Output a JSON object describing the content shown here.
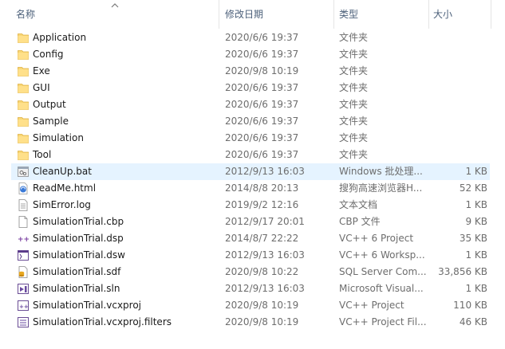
{
  "columns": {
    "name": "名称",
    "date": "修改日期",
    "type": "类型",
    "size": "大小"
  },
  "files": [
    {
      "name": "Application",
      "date": "2020/6/6 19:37",
      "type": "文件夹",
      "size": "",
      "icon": "folder-icon"
    },
    {
      "name": "Config",
      "date": "2020/6/6 19:37",
      "type": "文件夹",
      "size": "",
      "icon": "folder-icon"
    },
    {
      "name": "Exe",
      "date": "2020/9/8 10:19",
      "type": "文件夹",
      "size": "",
      "icon": "folder-icon"
    },
    {
      "name": "GUI",
      "date": "2020/6/6 19:37",
      "type": "文件夹",
      "size": "",
      "icon": "folder-icon"
    },
    {
      "name": "Output",
      "date": "2020/6/6 19:37",
      "type": "文件夹",
      "size": "",
      "icon": "folder-icon"
    },
    {
      "name": "Sample",
      "date": "2020/6/6 19:37",
      "type": "文件夹",
      "size": "",
      "icon": "folder-icon"
    },
    {
      "name": "Simulation",
      "date": "2020/6/6 19:37",
      "type": "文件夹",
      "size": "",
      "icon": "folder-icon"
    },
    {
      "name": "Tool",
      "date": "2020/6/6 19:37",
      "type": "文件夹",
      "size": "",
      "icon": "folder-icon"
    },
    {
      "name": "CleanUp.bat",
      "date": "2012/9/13 16:03",
      "type": "Windows 批处理...",
      "size": "1 KB",
      "icon": "batch-file-icon",
      "hover": true
    },
    {
      "name": "ReadMe.html",
      "date": "2014/8/8 20:13",
      "type": "搜狗高速浏览器H...",
      "size": "52 KB",
      "icon": "html-file-icon"
    },
    {
      "name": "SimError.log",
      "date": "2019/9/2 12:16",
      "type": "文本文档",
      "size": "1 KB",
      "icon": "text-file-icon"
    },
    {
      "name": "SimulationTrial.cbp",
      "date": "2012/9/17 20:01",
      "type": "CBP 文件",
      "size": "9 KB",
      "icon": "blank-file-icon"
    },
    {
      "name": "SimulationTrial.dsp",
      "date": "2014/8/7 22:22",
      "type": "VC++ 6 Project",
      "size": "35 KB",
      "icon": "vc-project-icon"
    },
    {
      "name": "SimulationTrial.dsw",
      "date": "2012/9/13 16:03",
      "type": "VC++ 6 Worksp...",
      "size": "1 KB",
      "icon": "vc-workspace-icon"
    },
    {
      "name": "SimulationTrial.sdf",
      "date": "2020/9/8 10:22",
      "type": "SQL Server Com...",
      "size": "33,856 KB",
      "icon": "database-file-icon"
    },
    {
      "name": "SimulationTrial.sln",
      "date": "2012/9/13 16:03",
      "type": "Microsoft Visual...",
      "size": "1 KB",
      "icon": "solution-file-icon"
    },
    {
      "name": "SimulationTrial.vcxproj",
      "date": "2020/9/8 10:19",
      "type": "VC++ Project",
      "size": "110 KB",
      "icon": "vcxproj-file-icon"
    },
    {
      "name": "SimulationTrial.vcxproj.filters",
      "date": "2020/9/8 10:19",
      "type": "VC++ Project Fil...",
      "size": "46 KB",
      "icon": "filters-file-icon"
    }
  ],
  "colors": {
    "header_text": "#4c607a",
    "hover_row": "#e5f3ff",
    "folder": "#f8d775",
    "secondary_text": "#6d6d6d"
  }
}
